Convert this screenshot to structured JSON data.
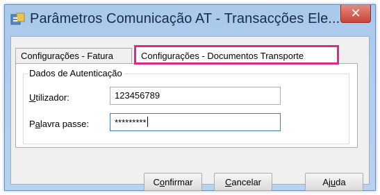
{
  "window": {
    "title": "Parâmetros Comunicação AT - Transacções Ele...",
    "close_glyph": "✕",
    "highlight_color": "#e0278a"
  },
  "tabs": [
    {
      "label": "Configurações - Fatura",
      "selected": false
    },
    {
      "label": "Configurações - Documentos Transporte",
      "selected": true
    }
  ],
  "group": {
    "label": "Dados de Autenticação"
  },
  "fields": {
    "user": {
      "label": "Utilizador:",
      "value": "123456789"
    },
    "password": {
      "label": "Palavra passe:",
      "value": "*********"
    }
  },
  "buttons": {
    "confirm": "Confirmar",
    "cancel": "Cancelar",
    "help": "Ajuda"
  }
}
